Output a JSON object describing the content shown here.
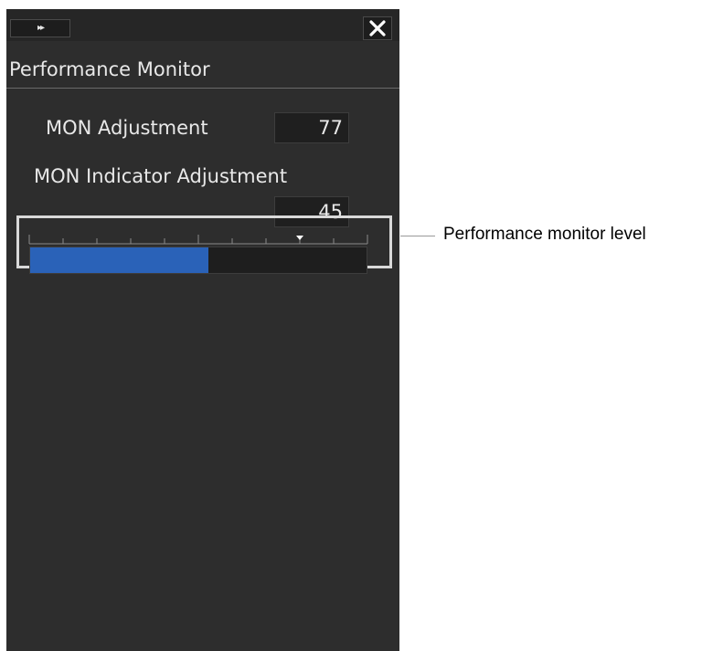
{
  "panel": {
    "expand_button_label": "▸▸",
    "title": "Performance Monitor",
    "mon_adjustment": {
      "label": "MON Adjustment",
      "value": "77"
    },
    "mon_indicator_adjustment": {
      "label": "MON Indicator Adjustment",
      "value": "45"
    },
    "level_bar": {
      "level_fraction": 0.53,
      "marker_fraction": 0.8,
      "tick_count": 10
    }
  },
  "annotation": {
    "callout_text": "Performance monitor level"
  },
  "colors": {
    "panel_background": "#2d2d2d",
    "bar_fill": "#2a62b8",
    "text": "#e8e8e8"
  },
  "icons": {
    "expand": "double-chevron-right-icon",
    "close": "close-icon"
  }
}
